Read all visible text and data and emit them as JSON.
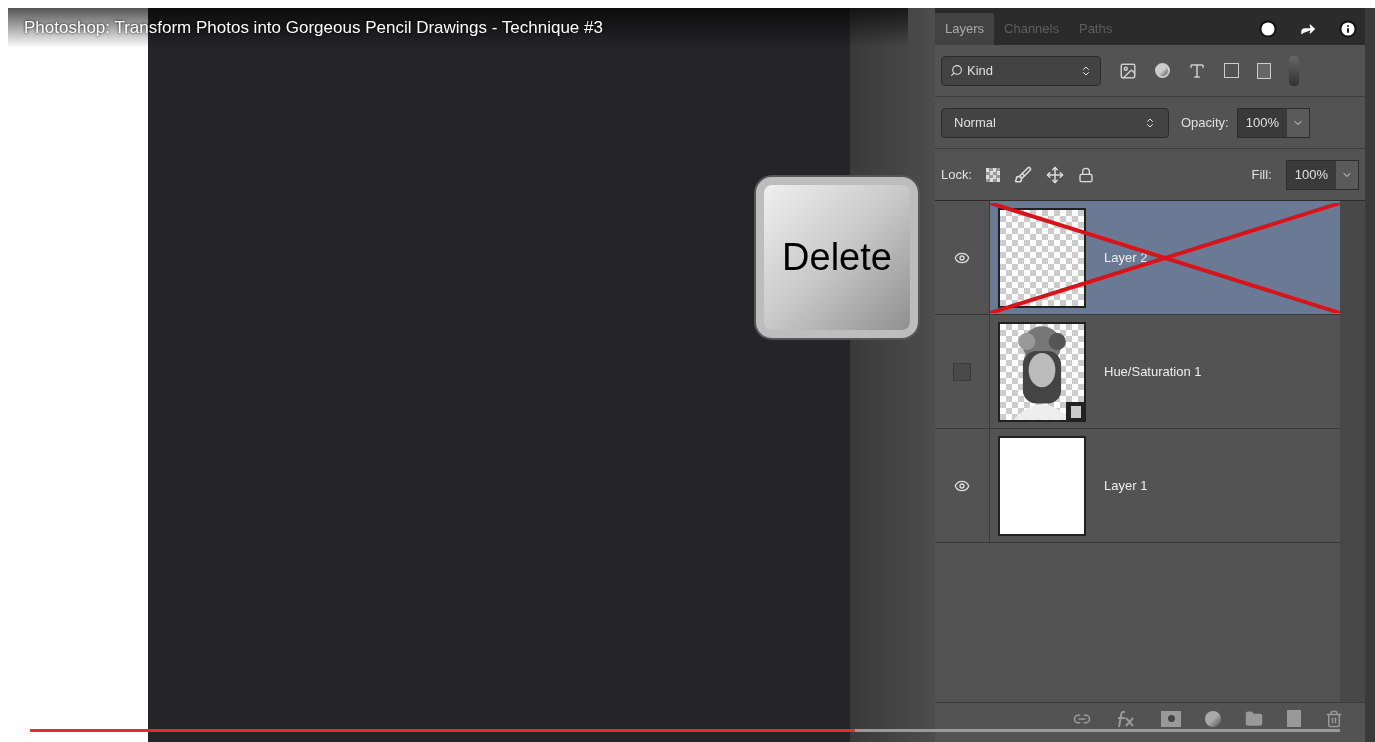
{
  "video": {
    "title": "Photoshop: Transform Photos into Gorgeous Pencil Drawings - Technique #3",
    "progress": {
      "level": 0.63
    }
  },
  "key_overlay": {
    "label": "Delete"
  },
  "layers_panel": {
    "tabs": [
      {
        "label": "Layers",
        "selected": true
      },
      {
        "label": "Channels",
        "selected": false
      },
      {
        "label": "Paths",
        "selected": false
      }
    ],
    "filter": {
      "value": "Kind"
    },
    "blend_mode": {
      "value": "Normal"
    },
    "opacity": {
      "label": "Opacity:",
      "value": "100%"
    },
    "lock": {
      "label": "Lock:"
    },
    "fill": {
      "label": "Fill:",
      "value": "100%"
    },
    "layers": [
      {
        "name": "Layer 2",
        "visible": true,
        "selected": true,
        "crossed_out": true,
        "kind": "transparent"
      },
      {
        "name": "Hue/Saturation 1",
        "visible": false,
        "selected": false,
        "crossed_out": false
      },
      {
        "name": "Layer 1",
        "visible": true,
        "selected": false,
        "crossed_out": false,
        "kind": "white"
      }
    ]
  }
}
